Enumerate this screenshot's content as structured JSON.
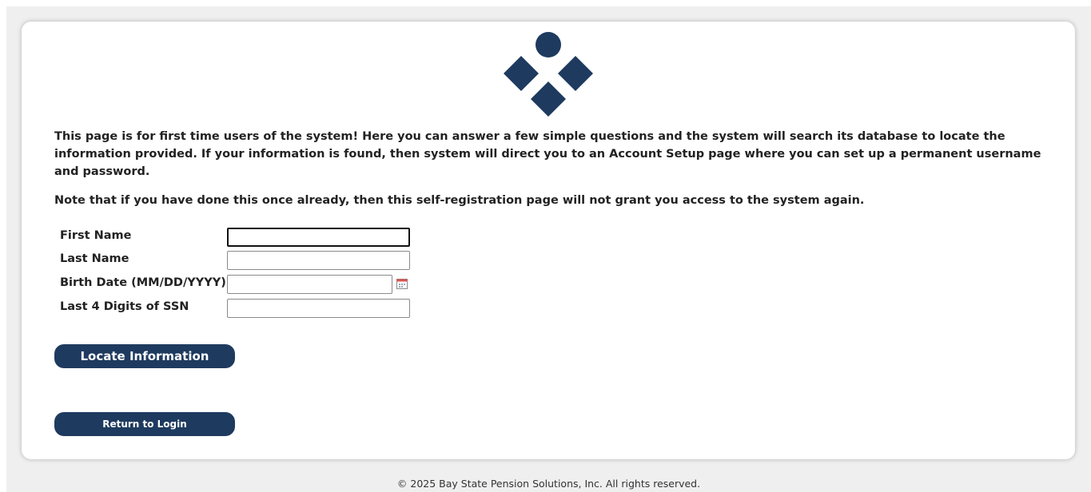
{
  "intro_text": "This page is for first time users of the system! Here you can answer a few simple questions and the system will search its database to locate the information provided. If your information is found, then system will direct you to an Account Setup page where you can set up a permanent username and password.",
  "note_text": "Note that if you have done this once already, then this self-registration page will not grant you access to the system again.",
  "form": {
    "first_name_label": "First Name",
    "first_name_value": "",
    "last_name_label": "Last Name",
    "last_name_value": "",
    "birth_date_label": "Birth Date (MM/DD/YYYY)",
    "birth_date_value": "",
    "ssn_label": "Last 4 Digits of SSN",
    "ssn_value": ""
  },
  "buttons": {
    "locate": "Locate Information",
    "return_login": "Return to Login"
  },
  "footer": "© 2025 Bay State Pension Solutions, Inc. All rights reserved.",
  "colors": {
    "brand": "#1e3a5f",
    "background": "#efefef"
  },
  "icons": {
    "logo": "company-logo",
    "calendar": "calendar-icon"
  }
}
